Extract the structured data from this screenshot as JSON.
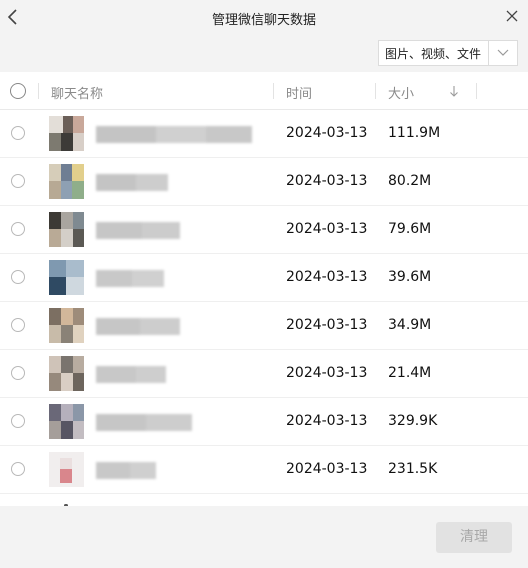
{
  "window": {
    "title": "管理微信聊天数据"
  },
  "filter": {
    "selected": "图片、视频、文件"
  },
  "table": {
    "headers": {
      "name": "聊天名称",
      "time": "时间",
      "size": "大小"
    },
    "rows": [
      {
        "time": "2024-03-13",
        "size": "111.9M"
      },
      {
        "time": "2024-03-13",
        "size": "80.2M"
      },
      {
        "time": "2024-03-13",
        "size": "79.6M"
      },
      {
        "time": "2024-03-13",
        "size": "39.6M"
      },
      {
        "time": "2024-03-13",
        "size": "34.9M"
      },
      {
        "time": "2024-03-13",
        "size": "21.4M"
      },
      {
        "time": "2024-03-13",
        "size": "329.9K"
      },
      {
        "time": "2024-03-13",
        "size": "231.5K"
      }
    ]
  },
  "footer": {
    "clean_label": "清理"
  },
  "icons": {
    "back": "chevron-left-icon",
    "close": "close-icon",
    "dropdown": "chevron-down-icon",
    "sort": "arrow-down-icon"
  },
  "colors": {
    "background": "#f3f3f3",
    "panel": "#ffffff",
    "text": "#111111",
    "muted": "#8a8a8a",
    "disabled_button": "#e2e2e2"
  }
}
